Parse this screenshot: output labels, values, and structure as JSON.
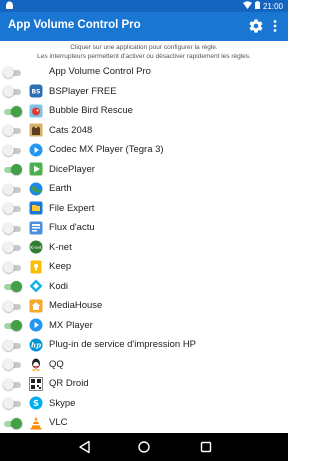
{
  "statusbar": {
    "left_icon": "android-icon",
    "time": "21:00"
  },
  "appbar": {
    "title": "App Volume Control Pro"
  },
  "hint": {
    "line1": "Cliquer sur une application pour configurer la règle.",
    "line2": "Les interrupteurs permettent d'activer ou désactiver rapidement les règles."
  },
  "apps": [
    {
      "name": "App Volume Control Pro",
      "on": false,
      "icon": "none"
    },
    {
      "name": "BSPlayer FREE",
      "on": false,
      "icon": "bsplayer"
    },
    {
      "name": "Bubble Bird Rescue",
      "on": true,
      "icon": "bubble"
    },
    {
      "name": "Cats 2048",
      "on": false,
      "icon": "cats"
    },
    {
      "name": "Codec MX Player (Tegra 3)",
      "on": false,
      "icon": "play"
    },
    {
      "name": "DicePlayer",
      "on": true,
      "icon": "dice"
    },
    {
      "name": "Earth",
      "on": false,
      "icon": "earth"
    },
    {
      "name": "File Expert",
      "on": false,
      "icon": "file"
    },
    {
      "name": "Flux d'actu",
      "on": false,
      "icon": "flux"
    },
    {
      "name": "K-net",
      "on": false,
      "icon": "knet"
    },
    {
      "name": "Keep",
      "on": false,
      "icon": "keep"
    },
    {
      "name": "Kodi",
      "on": true,
      "icon": "kodi"
    },
    {
      "name": "MediaHouse",
      "on": false,
      "icon": "mediahouse"
    },
    {
      "name": "MX Player",
      "on": true,
      "icon": "play"
    },
    {
      "name": "Plug-in de service d'impression HP",
      "on": false,
      "icon": "hp"
    },
    {
      "name": "QQ",
      "on": false,
      "icon": "qq"
    },
    {
      "name": "QR Droid",
      "on": false,
      "icon": "qr"
    },
    {
      "name": "Skype",
      "on": false,
      "icon": "skype"
    },
    {
      "name": "VLC",
      "on": true,
      "icon": "vlc"
    }
  ],
  "navbar": {
    "back": "back-icon",
    "home": "home-icon",
    "recent": "recent-apps-icon"
  }
}
